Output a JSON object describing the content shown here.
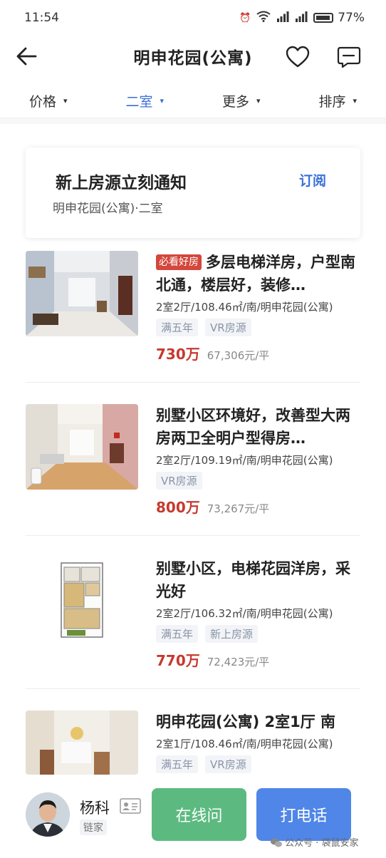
{
  "status": {
    "time": "11:54",
    "battery": "77%"
  },
  "nav": {
    "title": "明申花园(公寓)"
  },
  "filters": [
    {
      "label": "价格"
    },
    {
      "label": "二室"
    },
    {
      "label": "更多"
    },
    {
      "label": "排序"
    }
  ],
  "subscribe": {
    "title": "新上房源立刻通知",
    "desc": "明申花园(公寓)·二室",
    "button": "订阅"
  },
  "listings": [
    {
      "badge": "必看好房",
      "title": "多层电梯洋房，户型南北通，楼层好，装修…",
      "meta": "2室2厅/108.46㎡/南/明申花园(公寓)",
      "tags": [
        "满五年",
        "VR房源"
      ],
      "price": "730万",
      "unit_price": "67,306元/平"
    },
    {
      "title": "别墅小区环境好，改善型大两房两卫全明户型得房…",
      "meta": "2室2厅/109.19㎡/南/明申花园(公寓)",
      "tags": [
        "VR房源"
      ],
      "price": "800万",
      "unit_price": "73,267元/平"
    },
    {
      "title": "别墅小区，电梯花园洋房，采光好",
      "meta": "2室2厅/106.32㎡/南/明申花园(公寓)",
      "tags": [
        "满五年",
        "新上房源"
      ],
      "price": "770万",
      "unit_price": "72,423元/平"
    },
    {
      "title": "明申花园(公寓) 2室1厅 南",
      "meta": "2室1厅/108.46㎡/南/明申花园(公寓)",
      "tags": [
        "满五年",
        "VR房源"
      ]
    }
  ],
  "agent": {
    "name": "杨科",
    "company": "链家"
  },
  "actions": {
    "online": "在线问",
    "call": "打电话"
  },
  "watermark": "公众号 · 袋鼠安家",
  "colors": {
    "accent": "#3a6fd8",
    "price": "#c63a2f",
    "online": "#5cba80",
    "call": "#4f86e8"
  }
}
